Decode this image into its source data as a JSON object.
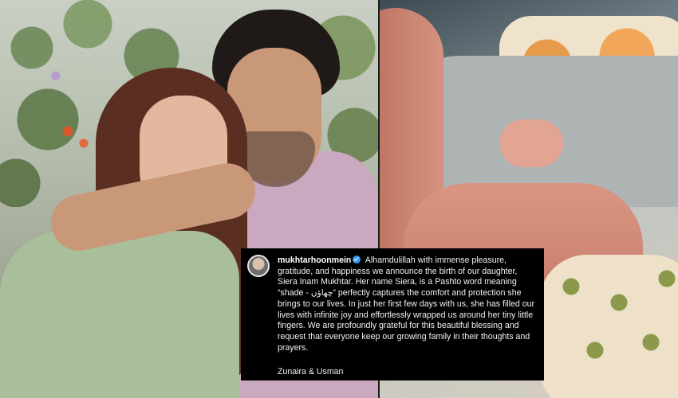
{
  "post": {
    "username": "mukhtarhoonmein",
    "caption": "Alhamdulillah with immense pleasure, gratitude, and happiness we announce the birth of our daughter, Siera Inam Mukhtar. Her name Siera, is a Pashto word meaning “shade - چھاؤں” perfectly captures the comfort and protection she brings to our lives. In just her first few days with us, she has filled our lives with infinite joy and effortlessly wrapped us around her tiny little fingers. We are profoundly grateful for this beautiful blessing and request that everyone keep our growing family in their thoughts and prayers.",
    "signature": "Zunaira & Usman",
    "verified_color": "#3897f0"
  },
  "icons": {
    "verified": "verified-badge-icon",
    "avatar": "profile-avatar"
  }
}
